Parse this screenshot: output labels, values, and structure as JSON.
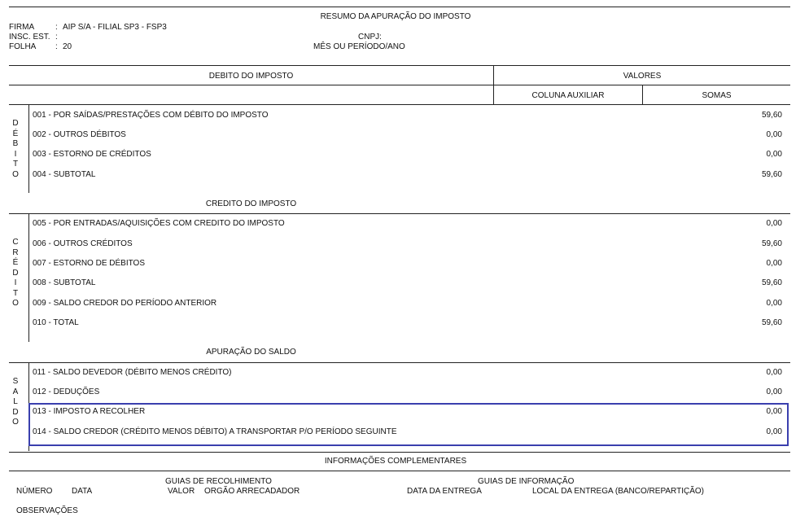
{
  "title": "RESUMO DA APURAÇÃO DO IMPOSTO",
  "header": {
    "firma_label": "FIRMA",
    "firma_value": "AIP S/A - FILIAL SP3 - FSP3",
    "insc_label": "INSC. EST.",
    "folha_label": "FOLHA",
    "folha_value": "20",
    "sep": ":",
    "cnpj_label": "CNPJ:",
    "mes_label": "MÊS OU PERÍODO/ANO"
  },
  "table_header": {
    "debito_title": "DEBITO DO IMPOSTO",
    "valores": "VALORES",
    "coluna_auxiliar": "COLUNA AUXILIAR",
    "somas": "SOMAS"
  },
  "debito": {
    "side": [
      "D",
      "É",
      "B",
      "I",
      "T",
      "O"
    ],
    "rows": [
      {
        "label": "001 - POR SAÍDAS/PRESTAÇÕES COM DÉBITO DO IMPOSTO",
        "value": "59,60"
      },
      {
        "label": "002 - OUTROS DÉBITOS",
        "value": "0,00"
      },
      {
        "label": "003 - ESTORNO DE CRÉDITOS",
        "value": "0,00"
      },
      {
        "label": "004 - SUBTOTAL",
        "value": "59,60"
      }
    ]
  },
  "credito": {
    "title": "CREDITO DO IMPOSTO",
    "side": [
      "C",
      "R",
      "É",
      "D",
      "I",
      "T",
      "O"
    ],
    "rows": [
      {
        "label": "005 - POR ENTRADAS/AQUISIÇÕES COM CREDITO DO IMPOSTO",
        "value": "0,00"
      },
      {
        "label": "006 - OUTROS CRÉDITOS",
        "value": "59,60"
      },
      {
        "label": "007 - ESTORNO DE DÉBITOS",
        "value": "0,00"
      },
      {
        "label": "008 - SUBTOTAL",
        "value": "59,60"
      },
      {
        "label": "009 - SALDO CREDOR DO PERÍODO ANTERIOR",
        "value": "0,00"
      },
      {
        "label": "010 - TOTAL",
        "value": "59,60"
      }
    ]
  },
  "saldo": {
    "title": "APURAÇÃO DO SALDO",
    "side": [
      "S",
      "A",
      "L",
      "D",
      "O"
    ],
    "rows": [
      {
        "label": "011 - SALDO DEVEDOR (DÉBITO MENOS CRÉDITO)",
        "value": "0,00"
      },
      {
        "label": "012 - DEDUÇÕES",
        "value": "0,00"
      },
      {
        "label": "013 - IMPOSTO A RECOLHER",
        "value": "0,00"
      },
      {
        "label": "014 - SALDO CREDOR (CRÉDITO MENOS DÉBITO) A TRANSPORTAR P/O PERÍODO SEGUINTE",
        "value": "0,00"
      }
    ]
  },
  "info": {
    "title": "INFORMAÇÕES COMPLEMENTARES",
    "guias_recolhimento": "GUIAS DE RECOLHIMENTO",
    "guias_informacao": "GUIAS DE INFORMAÇÃO",
    "numero": "NÚMERO",
    "data": "DATA",
    "valor": "VALOR",
    "orgao": "ORGÃO ARRECADADOR",
    "data_entrega": "DATA DA ENTREGA",
    "local_entrega": "LOCAL DA ENTREGA (BANCO/REPARTIÇÃO)",
    "observacoes": "OBSERVAÇÕES"
  },
  "colors": {
    "highlight": "#3a3fae",
    "line": "#222222"
  }
}
